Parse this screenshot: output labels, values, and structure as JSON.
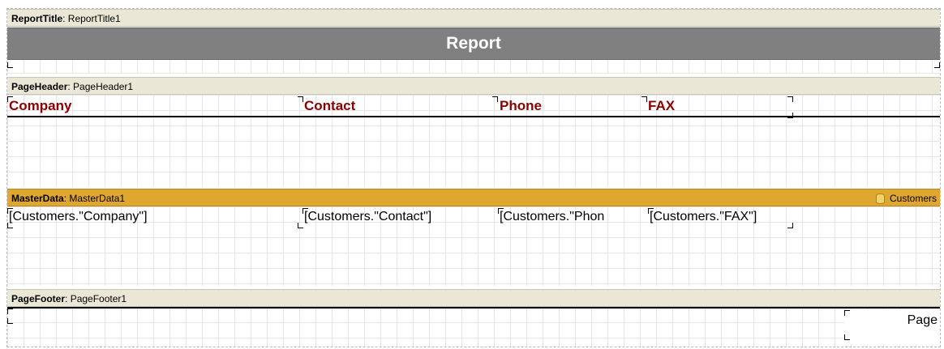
{
  "report_title_band": {
    "type": "ReportTitle",
    "name": "ReportTitle1",
    "title_text": "Report"
  },
  "page_header_band": {
    "type": "PageHeader",
    "name": "PageHeader1",
    "columns": [
      "Company",
      "Contact",
      "Phone",
      "FAX"
    ]
  },
  "master_data_band": {
    "type": "MasterData",
    "name": "MasterData1",
    "datasource": "Customers",
    "fields": [
      "[Customers.\"Company\"]",
      "[Customers.\"Contact\"]",
      "[Customers.\"Phon",
      "[Customers.\"FAX\"]"
    ]
  },
  "page_footer_band": {
    "type": "PageFooter",
    "name": "PageFooter1",
    "page_text": "Page"
  },
  "colors": {
    "band_header": "#ebe7d6",
    "master_header": "#e0a730",
    "title_bar": "#808080",
    "column_header_text": "#8b0000"
  }
}
